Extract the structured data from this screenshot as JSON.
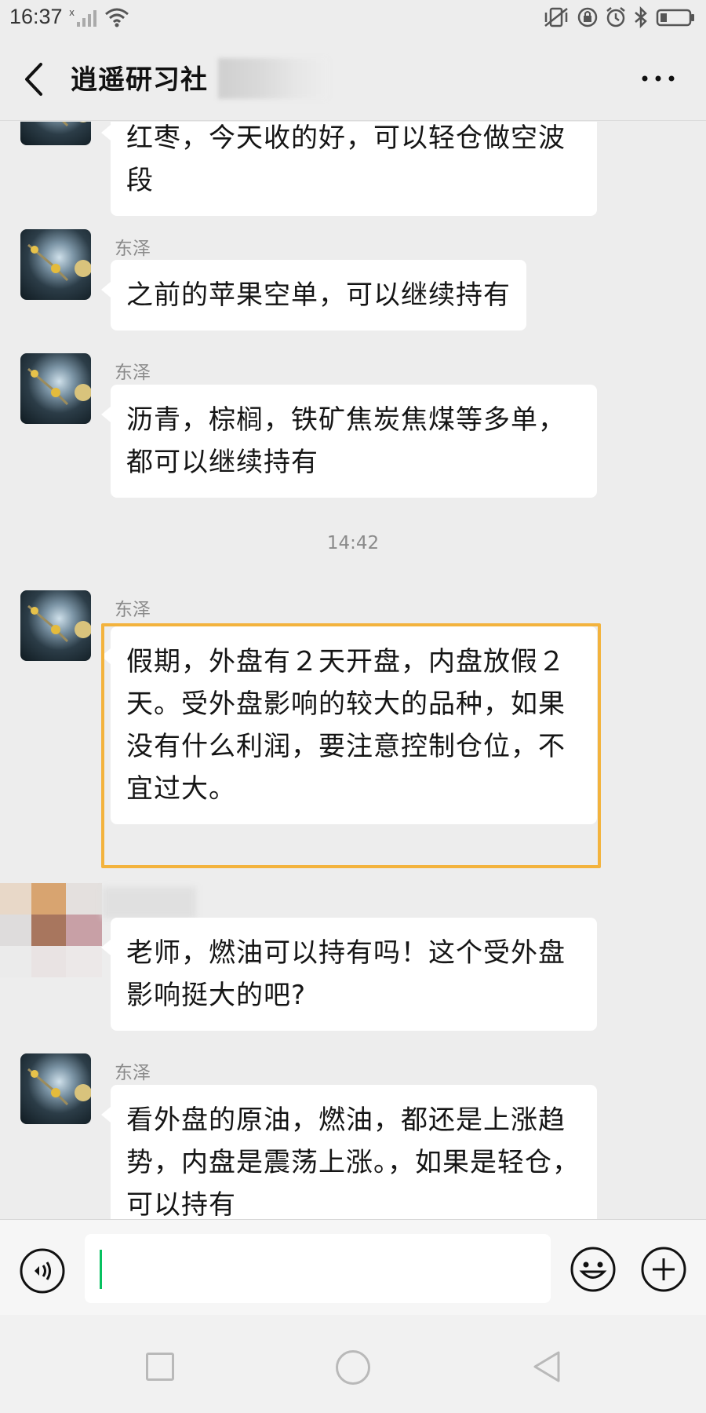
{
  "status_bar": {
    "time": "16:37",
    "icons": [
      "no-sim-icon",
      "wifi-icon",
      "vibrate-icon",
      "lock-rotation-icon",
      "alarm-icon",
      "bluetooth-icon",
      "battery-icon"
    ]
  },
  "header": {
    "title": "逍遥研习社",
    "back_icon": "chevron-left-icon",
    "more_icon": "more-horizontal-icon"
  },
  "messages": [
    {
      "sender": "",
      "text": "红枣，今天收的好，可以轻仓做空波段"
    },
    {
      "sender": "东泽",
      "text": "之前的苹果空单，可以继续持有"
    },
    {
      "sender": "东泽",
      "text": "沥青，棕榈，铁矿焦炭焦煤等多单，都可以继续持有"
    },
    {
      "timestamp": "14:42"
    },
    {
      "sender": "东泽",
      "text": "假期，外盘有２天开盘，内盘放假２天。受外盘影响的较大的品种，如果没有什么利润，要注意控制仓位，不宜过大。",
      "highlighted": true
    },
    {
      "sender": "",
      "text": "老师，燃油可以持有吗！这个受外盘影响挺大的吧?"
    },
    {
      "sender": "东泽",
      "text": "看外盘的原油，燃油，都还是上涨趋势，内盘是震荡上涨。，如果是轻仓，可以持有"
    }
  ],
  "input_bar": {
    "voice_icon": "voice-icon",
    "input_value": "",
    "emoji_icon": "emoji-icon",
    "plus_icon": "plus-circle-icon"
  },
  "nav_bar": {
    "icons": [
      "recent-apps-icon",
      "home-icon",
      "back-triangle-icon"
    ]
  },
  "colors": {
    "background": "#ededed",
    "bubble": "#ffffff",
    "highlight": "#f3b33d",
    "caret": "#07c160"
  }
}
